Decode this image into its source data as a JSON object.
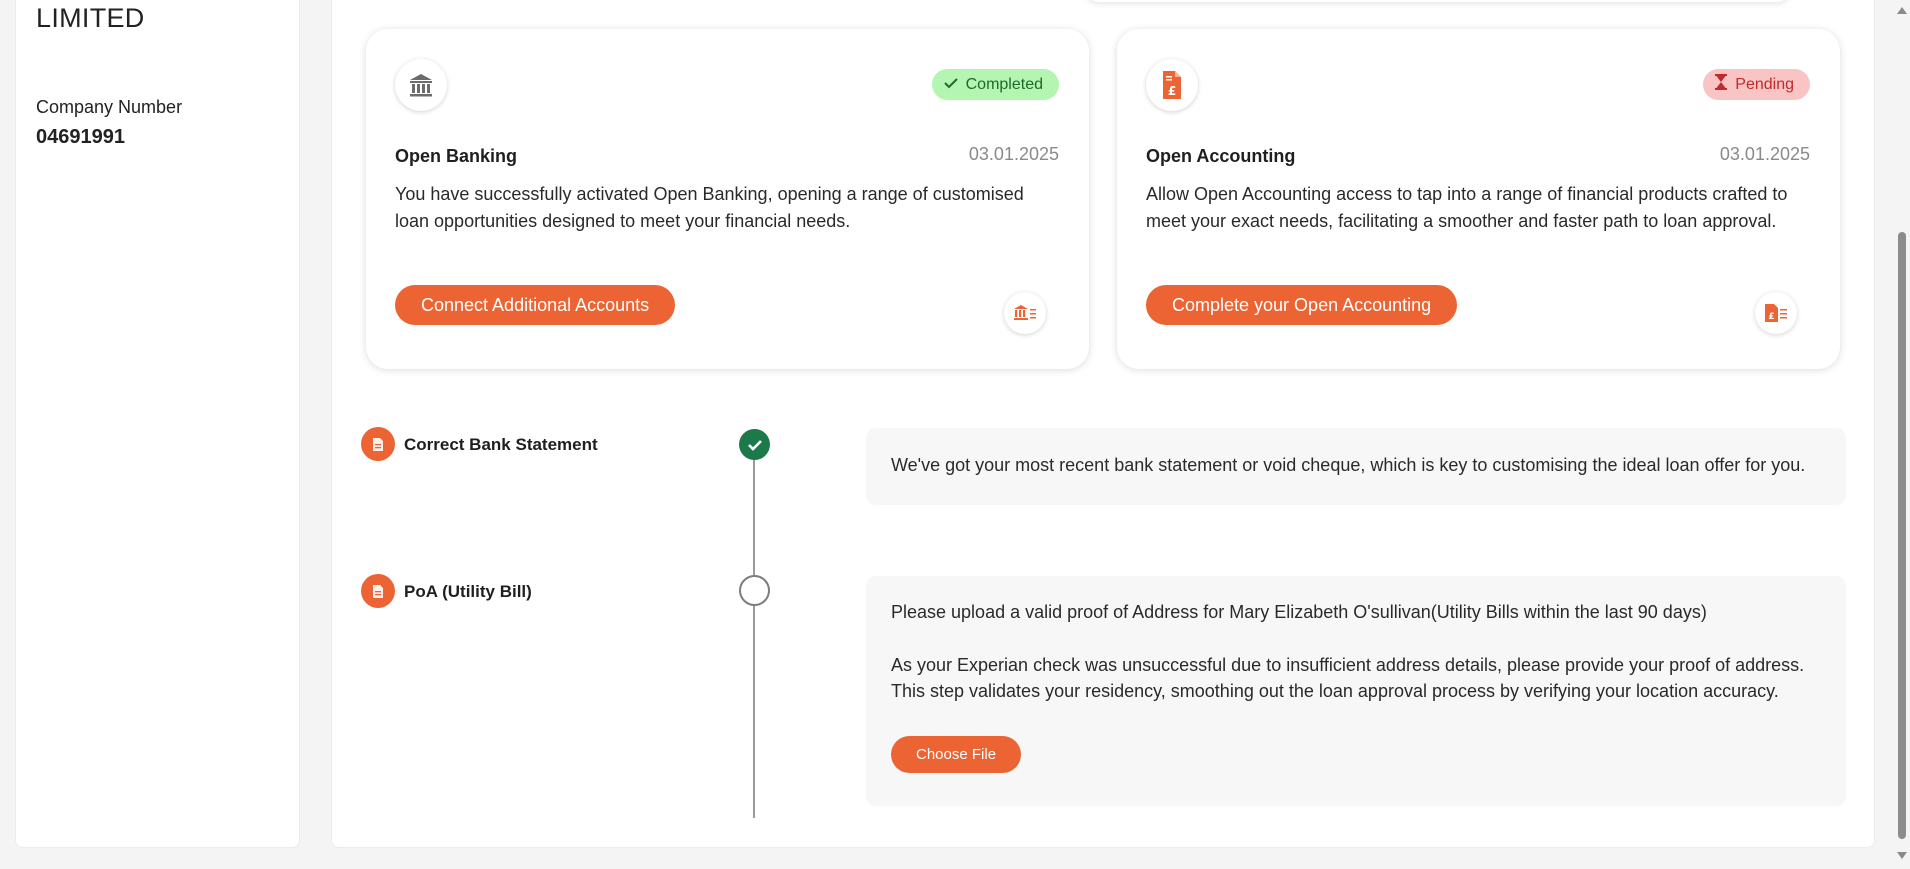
{
  "company": {
    "name": "LIMITED",
    "number_label": "Company Number",
    "number_value": "04691991"
  },
  "cards": [
    {
      "title": "Open Banking",
      "date": "03.01.2025",
      "status": "Completed",
      "status_icon": "check-icon",
      "icon": "bank-icon",
      "description": "You have successfully activated Open Banking, opening a range of customised loan opportunities designed to meet your financial needs.",
      "button_label": "Connect Additional Accounts",
      "mini_icon": "bank-list-icon"
    },
    {
      "title": "Open Accounting",
      "date": "03.01.2025",
      "status": "Pending",
      "status_icon": "hourglass-icon",
      "icon": "pound-document-icon",
      "description": "Allow Open Accounting access to tap into a range of financial products crafted to meet your exact needs, facilitating a smoother and faster path to loan approval.",
      "button_label": "Complete your Open Accounting",
      "mini_icon": "pound-document-list-icon"
    }
  ],
  "timeline": [
    {
      "label": "Correct Bank Statement",
      "state": "complete",
      "text": "We've got your most recent bank statement or void cheque, which is key to customising the ideal loan offer for you."
    },
    {
      "label": "PoA (Utility Bill)",
      "state": "pending",
      "text": "Please upload a valid proof of Address for Mary Elizabeth O'sullivan(Utility Bills within the last 90 days)",
      "text2": "As your Experian check was unsuccessful due to insufficient address details, please provide your proof of address. This step validates your residency, smoothing out the loan approval process by verifying your location accuracy.",
      "button_label": "Choose File"
    }
  ],
  "colors": {
    "accent": "#ec6433",
    "completed_bg": "#b3f5b1",
    "completed_text": "#1d6b2b",
    "pending_bg": "#f9c4c4",
    "pending_text": "#c12a2a",
    "done_node": "#1c7a4a"
  }
}
